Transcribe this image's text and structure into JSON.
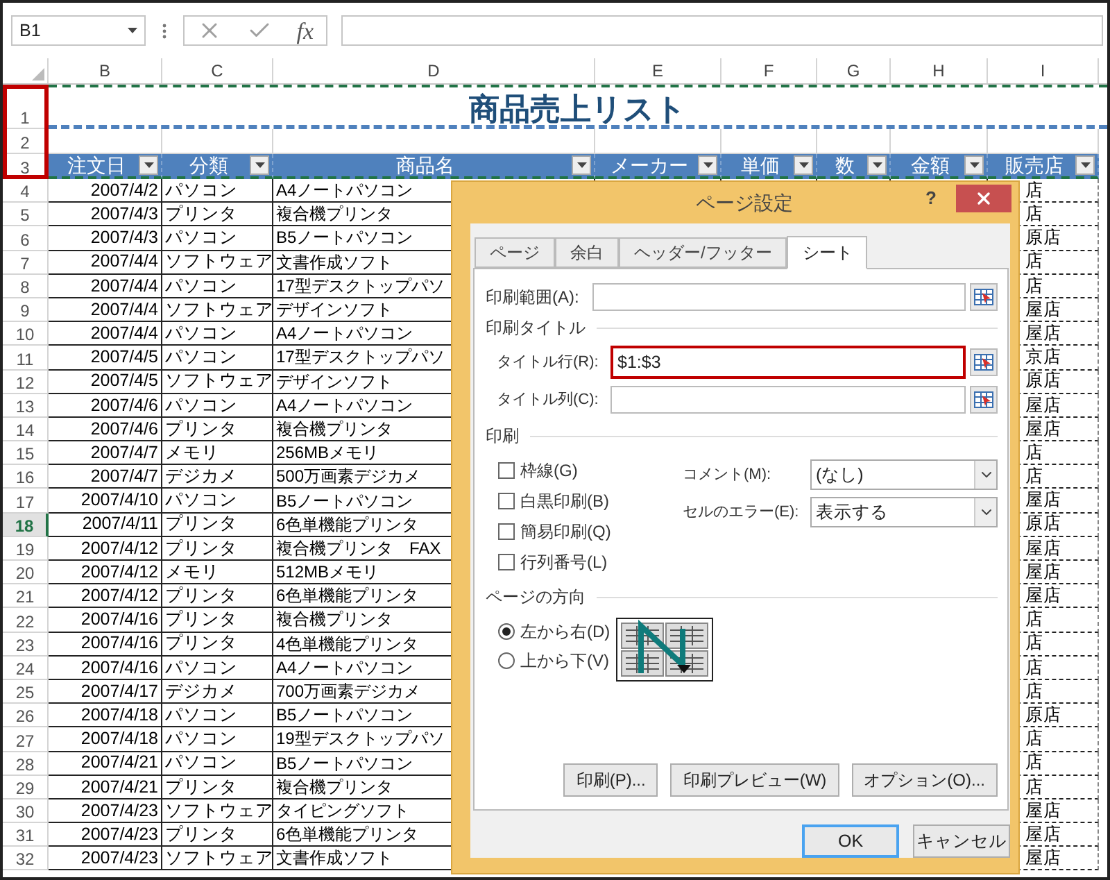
{
  "formula_bar": {
    "name_box": "B1",
    "function_label": "fx"
  },
  "sheet": {
    "columns": [
      "B",
      "C",
      "D",
      "E",
      "F",
      "G",
      "H",
      "I"
    ],
    "print_title_rows_marked": true,
    "rows": [
      {
        "kind": "title",
        "number": "1",
        "selected": false,
        "text": "商品売上リスト"
      },
      {
        "kind": "blank",
        "number": "2",
        "selected": false
      },
      {
        "kind": "header",
        "number": "3",
        "selected": false,
        "cells": [
          "注文日",
          "分類",
          "商品名",
          "メーカー",
          "単価",
          "数",
          "金額",
          "販売店"
        ]
      },
      {
        "kind": "data",
        "number": "4",
        "selected": false,
        "cells": [
          "2007/4/2",
          "パソコン",
          "A4ノートパソコン",
          "店"
        ]
      },
      {
        "kind": "data",
        "number": "5",
        "selected": false,
        "cells": [
          "2007/4/3",
          "プリンタ",
          "複合機プリンタ",
          "店"
        ]
      },
      {
        "kind": "data",
        "number": "6",
        "selected": false,
        "cells": [
          "2007/4/3",
          "パソコン",
          "B5ノートパソコン",
          "原店"
        ]
      },
      {
        "kind": "data",
        "number": "7",
        "selected": false,
        "cells": [
          "2007/4/4",
          "ソフトウェア",
          "文書作成ソフト",
          "店"
        ]
      },
      {
        "kind": "data",
        "number": "8",
        "selected": false,
        "cells": [
          "2007/4/4",
          "パソコン",
          "17型デスクトップパソ",
          "店"
        ]
      },
      {
        "kind": "data",
        "number": "9",
        "selected": false,
        "cells": [
          "2007/4/4",
          "ソフトウェア",
          "デザインソフト",
          "屋店"
        ]
      },
      {
        "kind": "data",
        "number": "10",
        "selected": false,
        "cells": [
          "2007/4/4",
          "パソコン",
          "A4ノートパソコン",
          "屋店"
        ]
      },
      {
        "kind": "data",
        "number": "11",
        "selected": false,
        "cells": [
          "2007/4/5",
          "パソコン",
          "17型デスクトップパソ",
          "京店"
        ]
      },
      {
        "kind": "data",
        "number": "12",
        "selected": false,
        "cells": [
          "2007/4/5",
          "ソフトウェア",
          "デザインソフト",
          "原店"
        ]
      },
      {
        "kind": "data",
        "number": "13",
        "selected": false,
        "cells": [
          "2007/4/6",
          "パソコン",
          "A4ノートパソコン",
          "屋店"
        ]
      },
      {
        "kind": "data",
        "number": "14",
        "selected": false,
        "cells": [
          "2007/4/6",
          "プリンタ",
          "複合機プリンタ",
          "屋店"
        ]
      },
      {
        "kind": "data",
        "number": "15",
        "selected": false,
        "cells": [
          "2007/4/7",
          "メモリ",
          "256MBメモリ",
          "店"
        ]
      },
      {
        "kind": "data",
        "number": "16",
        "selected": false,
        "cells": [
          "2007/4/7",
          "デジカメ",
          "500万画素デジカメ",
          "店"
        ]
      },
      {
        "kind": "data",
        "number": "17",
        "selected": false,
        "cells": [
          "2007/4/10",
          "パソコン",
          "B5ノートパソコン",
          "屋店"
        ]
      },
      {
        "kind": "data",
        "number": "18",
        "selected": true,
        "cells": [
          "2007/4/11",
          "プリンタ",
          "6色単機能プリンタ",
          "原店"
        ]
      },
      {
        "kind": "data",
        "number": "19",
        "selected": false,
        "cells": [
          "2007/4/12",
          "プリンタ",
          "複合機プリンタ　FAX",
          "屋店"
        ]
      },
      {
        "kind": "data",
        "number": "20",
        "selected": false,
        "cells": [
          "2007/4/12",
          "メモリ",
          "512MBメモリ",
          "屋店"
        ]
      },
      {
        "kind": "data",
        "number": "21",
        "selected": false,
        "cells": [
          "2007/4/12",
          "プリンタ",
          "6色単機能プリンタ",
          "屋店"
        ]
      },
      {
        "kind": "data",
        "number": "22",
        "selected": false,
        "cells": [
          "2007/4/16",
          "プリンタ",
          "複合機プリンタ",
          "店"
        ]
      },
      {
        "kind": "data",
        "number": "23",
        "selected": false,
        "cells": [
          "2007/4/16",
          "プリンタ",
          "4色単機能プリンタ",
          "店"
        ]
      },
      {
        "kind": "data",
        "number": "24",
        "selected": false,
        "cells": [
          "2007/4/16",
          "パソコン",
          "A4ノートパソコン",
          "店"
        ]
      },
      {
        "kind": "data",
        "number": "25",
        "selected": false,
        "cells": [
          "2007/4/17",
          "デジカメ",
          "700万画素デジカメ",
          "店"
        ]
      },
      {
        "kind": "data",
        "number": "26",
        "selected": false,
        "cells": [
          "2007/4/18",
          "パソコン",
          "B5ノートパソコン",
          "原店"
        ]
      },
      {
        "kind": "data",
        "number": "27",
        "selected": false,
        "cells": [
          "2007/4/18",
          "パソコン",
          "19型デスクトップパソ",
          "店"
        ]
      },
      {
        "kind": "data",
        "number": "28",
        "selected": false,
        "cells": [
          "2007/4/21",
          "パソコン",
          "B5ノートパソコン",
          "店"
        ]
      },
      {
        "kind": "data",
        "number": "29",
        "selected": false,
        "cells": [
          "2007/4/21",
          "プリンタ",
          "複合機プリンタ",
          "店"
        ]
      },
      {
        "kind": "data",
        "number": "30",
        "selected": false,
        "cells": [
          "2007/4/23",
          "ソフトウェア",
          "タイピングソフト",
          "屋店"
        ]
      },
      {
        "kind": "data",
        "number": "31",
        "selected": false,
        "cells": [
          "2007/4/23",
          "プリンタ",
          "6色単機能プリンタ",
          "屋店"
        ]
      },
      {
        "kind": "data",
        "number": "32",
        "selected": false,
        "cells": [
          "2007/4/23",
          "ソフトウェア",
          "文書作成ソフト",
          "屋店"
        ]
      }
    ]
  },
  "dialog": {
    "title": "ページ設定",
    "help": "?",
    "tabs": [
      {
        "label": "ページ",
        "selected": false
      },
      {
        "label": "余白",
        "selected": false
      },
      {
        "label": "ヘッダー/フッター",
        "selected": false
      },
      {
        "label": "シート",
        "selected": true
      }
    ],
    "print_area": {
      "label": "印刷範囲(A):"
    },
    "print_titles": {
      "heading": "印刷タイトル",
      "rows": {
        "label": "タイトル行(R):",
        "value": "$1:$3",
        "highlighted": true
      },
      "columns": {
        "label": "タイトル列(C):",
        "highlighted": false
      }
    },
    "print": {
      "heading": "印刷",
      "options": [
        {
          "label": "枠線(G)",
          "checked": false
        },
        {
          "label": "白黒印刷(B)",
          "checked": false
        },
        {
          "label": "簡易印刷(Q)",
          "checked": false
        },
        {
          "label": "行列番号(L)",
          "checked": false
        }
      ],
      "comment": {
        "label": "コメント(M):",
        "value": "(なし)"
      },
      "cell_errors": {
        "label": "セルのエラー(E):",
        "value": "表示する"
      }
    },
    "page_order": {
      "heading": "ページの方向",
      "options": [
        {
          "label": "左から右(D)",
          "selected": true
        },
        {
          "label": "上から下(V)",
          "selected": false
        }
      ]
    },
    "actions": [
      "印刷(P)...",
      "印刷プレビュー(W)",
      "オプション(O)..."
    ],
    "buttons": [
      {
        "label": "OK",
        "focused": true
      },
      {
        "label": "キャンセル",
        "focused": false
      }
    ]
  }
}
